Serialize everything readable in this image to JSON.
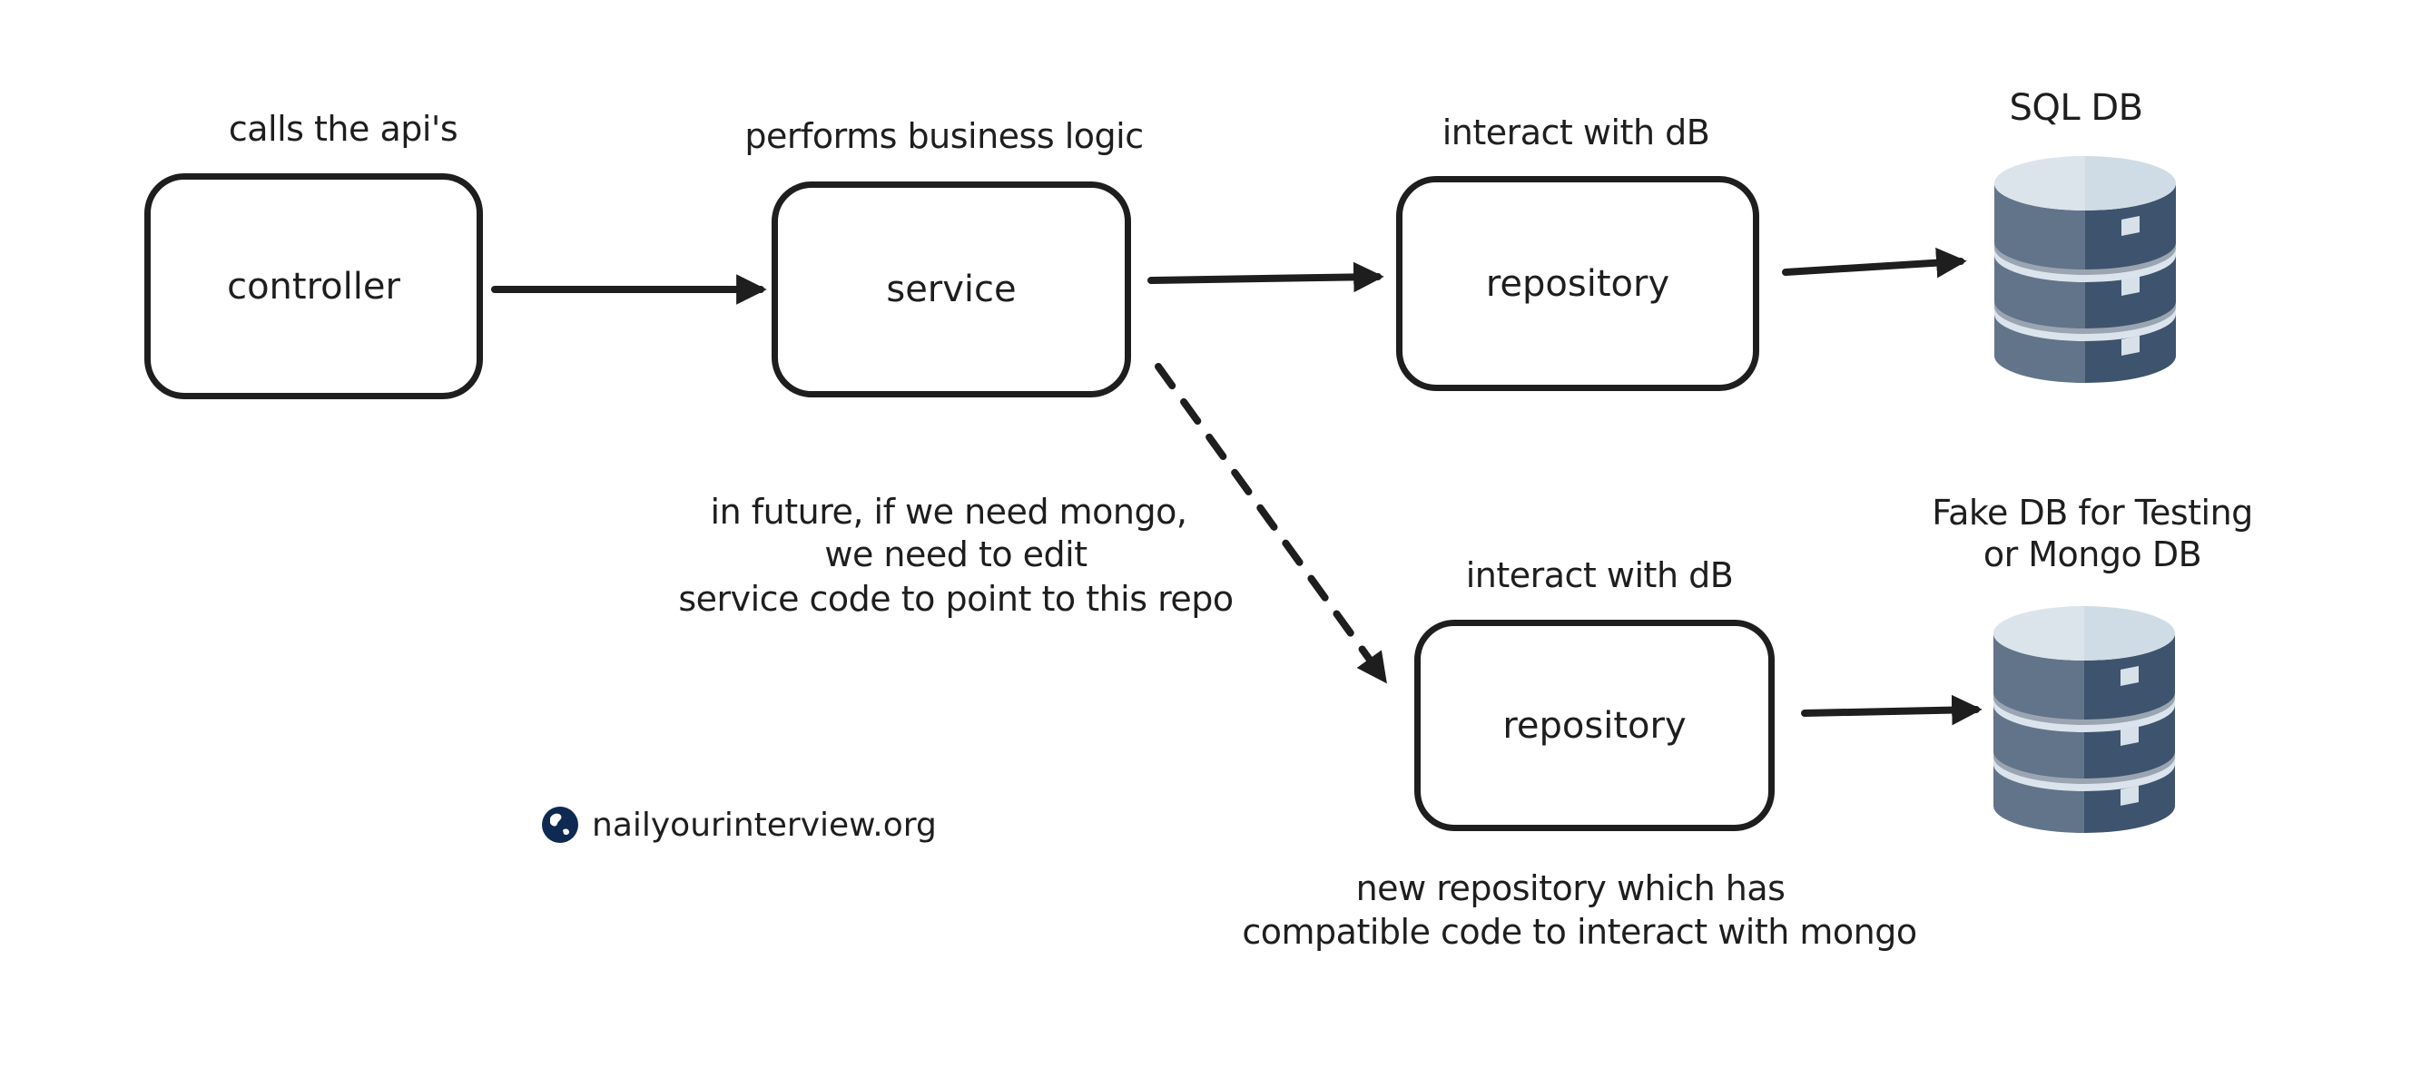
{
  "nodes": {
    "controller": {
      "label": "controller",
      "caption": "calls the api's"
    },
    "service": {
      "label": "service",
      "caption": "performs business logic"
    },
    "repository_sql": {
      "label": "repository",
      "caption": "interact with dB"
    },
    "repository_new": {
      "label": "repository",
      "caption": "interact with dB"
    }
  },
  "databases": {
    "sql": {
      "caption": "SQL DB"
    },
    "fake": {
      "caption_lines": [
        "Fake DB for Testing",
        "or Mongo DB"
      ]
    }
  },
  "notes": {
    "future": [
      "in future, if we need mongo,",
      "we need to edit",
      "service code to point to this repo"
    ],
    "new_repo": [
      "new repository which has",
      "compatible code to interact with mongo"
    ]
  },
  "watermark": {
    "text": "nailyourinterview.org",
    "icon": "globe-icon"
  },
  "edges": [
    {
      "from": "controller",
      "to": "service",
      "style": "solid"
    },
    {
      "from": "service",
      "to": "repository_sql",
      "style": "solid"
    },
    {
      "from": "repository_sql",
      "to": "sql",
      "style": "solid"
    },
    {
      "from": "service",
      "to": "repository_new",
      "style": "dashed"
    },
    {
      "from": "repository_new",
      "to": "fake",
      "style": "solid"
    }
  ],
  "colors": {
    "stroke": "#1e1e1e",
    "db_top": "#d7e1ea",
    "db_body_left": "#627489",
    "db_body_right": "#3e536d",
    "db_ring": "#dbe4ec",
    "globe": "#0e2a52"
  }
}
